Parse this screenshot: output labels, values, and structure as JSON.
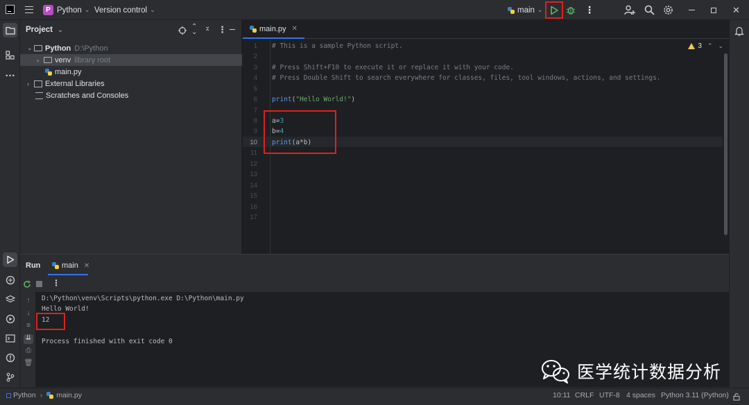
{
  "titlebar": {
    "project_badge": "P",
    "project_name": "Python",
    "vcs_label": "Version control",
    "run_config": "main"
  },
  "project_panel": {
    "title": "Project",
    "tree": [
      {
        "label": "Python",
        "sub": "D:\\Python",
        "level": 0,
        "expanded": true
      },
      {
        "label": "venv",
        "sub": "library root",
        "level": 1,
        "expanded": false
      },
      {
        "label": "main.py",
        "sub": "",
        "level": 1
      },
      {
        "label": "External Libraries",
        "sub": "",
        "level": 0,
        "expanded": false
      },
      {
        "label": "Scratches and Consoles",
        "sub": "",
        "level": 0
      }
    ]
  },
  "editor": {
    "tab_label": "main.py",
    "warnings_count": "3",
    "line_numbers": [
      "1",
      "2",
      "3",
      "4",
      "5",
      "6",
      "7",
      "8",
      "9",
      "10",
      "11",
      "12",
      "13",
      "14",
      "15",
      "16",
      "17"
    ],
    "lines": {
      "l1": "# This is a sample Python script.",
      "l3": "# Press Shift+F10 to execute it or replace it with your code.",
      "l4": "# Press Double Shift to search everywhere for classes, files, tool windows, actions, and settings.",
      "l6_fn": "print",
      "l6_open": "(",
      "l6_str": "\"Hello World!\"",
      "l6_close": ")",
      "l8_var": "a=",
      "l8_num": "3",
      "l9_var": "b=",
      "l9_num": "4",
      "l10_fn": "print",
      "l10_rest": "(a*b)"
    }
  },
  "run_panel": {
    "title": "Run",
    "tab_label": "main",
    "console": [
      "D:\\Python\\venv\\Scripts\\python.exe D:\\Python\\main.py",
      "Hello World!",
      "12",
      "",
      "Process finished with exit code 0"
    ]
  },
  "statusbar": {
    "crumb_project": "Python",
    "crumb_file": "main.py",
    "position": "10:11",
    "line_ending": "CRLF",
    "encoding": "UTF-8",
    "indent": "4 spaces",
    "interpreter": "Python 3.11 (Python)"
  },
  "watermark": {
    "text": "医学统计数据分析"
  },
  "colors": {
    "accent": "#3574f0",
    "highlight_box": "#e02020",
    "python_badge": "#b34fbf",
    "run_icon": "#5fb865",
    "debug_icon": "#5fb865",
    "warning": "#f2c55c"
  },
  "icons": [
    "logo-icon",
    "menu-icon",
    "run-icon",
    "debug-icon",
    "more-icon",
    "add-user-icon",
    "search-icon",
    "settings-icon",
    "minimize-icon",
    "restore-icon",
    "close-icon",
    "folder-icon",
    "structure-icon",
    "target-icon",
    "expand-icon",
    "collapse-icon",
    "python-icon",
    "rerun-icon",
    "stop-icon",
    "notifications-icon"
  ]
}
